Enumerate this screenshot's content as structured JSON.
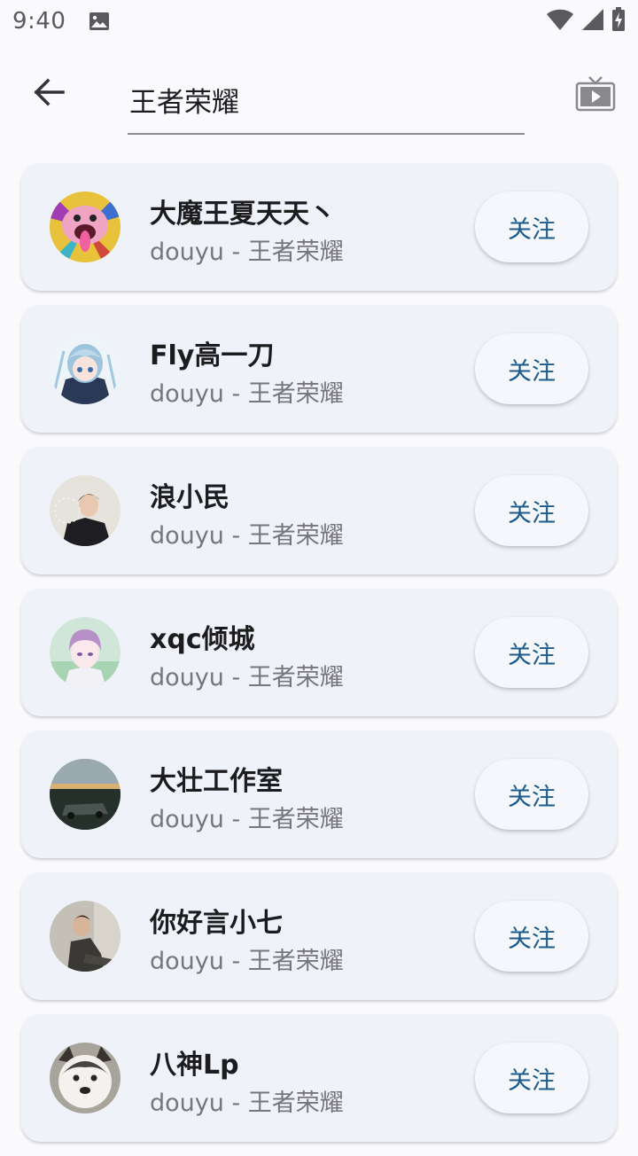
{
  "status_bar": {
    "time": "9:40",
    "icons": [
      "image-icon",
      "wifi-icon",
      "signal-icon",
      "battery-charging-icon"
    ]
  },
  "header": {
    "back_icon": "arrow-left-icon",
    "search_value": "王者荣耀",
    "tv_icon": "tv-icon"
  },
  "results": [
    {
      "name": "大魔王夏天天丶",
      "subtitle": "douyu - 王者荣耀",
      "follow_label": "关注"
    },
    {
      "name": "Fly高一刀",
      "subtitle": "douyu - 王者荣耀",
      "follow_label": "关注"
    },
    {
      "name": "浪小民",
      "subtitle": "douyu - 王者荣耀",
      "follow_label": "关注"
    },
    {
      "name": "xqc倾城",
      "subtitle": "douyu - 王者荣耀",
      "follow_label": "关注"
    },
    {
      "name": "大壮工作室",
      "subtitle": "douyu - 王者荣耀",
      "follow_label": "关注"
    },
    {
      "name": "你好言小七",
      "subtitle": "douyu - 王者荣耀",
      "follow_label": "关注"
    },
    {
      "name": "八神Lp",
      "subtitle": "douyu - 王者荣耀",
      "follow_label": "关注"
    }
  ],
  "colors": {
    "card_bg": "#eff2f9",
    "follow_text": "#1a5a8c",
    "subtitle_text": "#77777b"
  }
}
